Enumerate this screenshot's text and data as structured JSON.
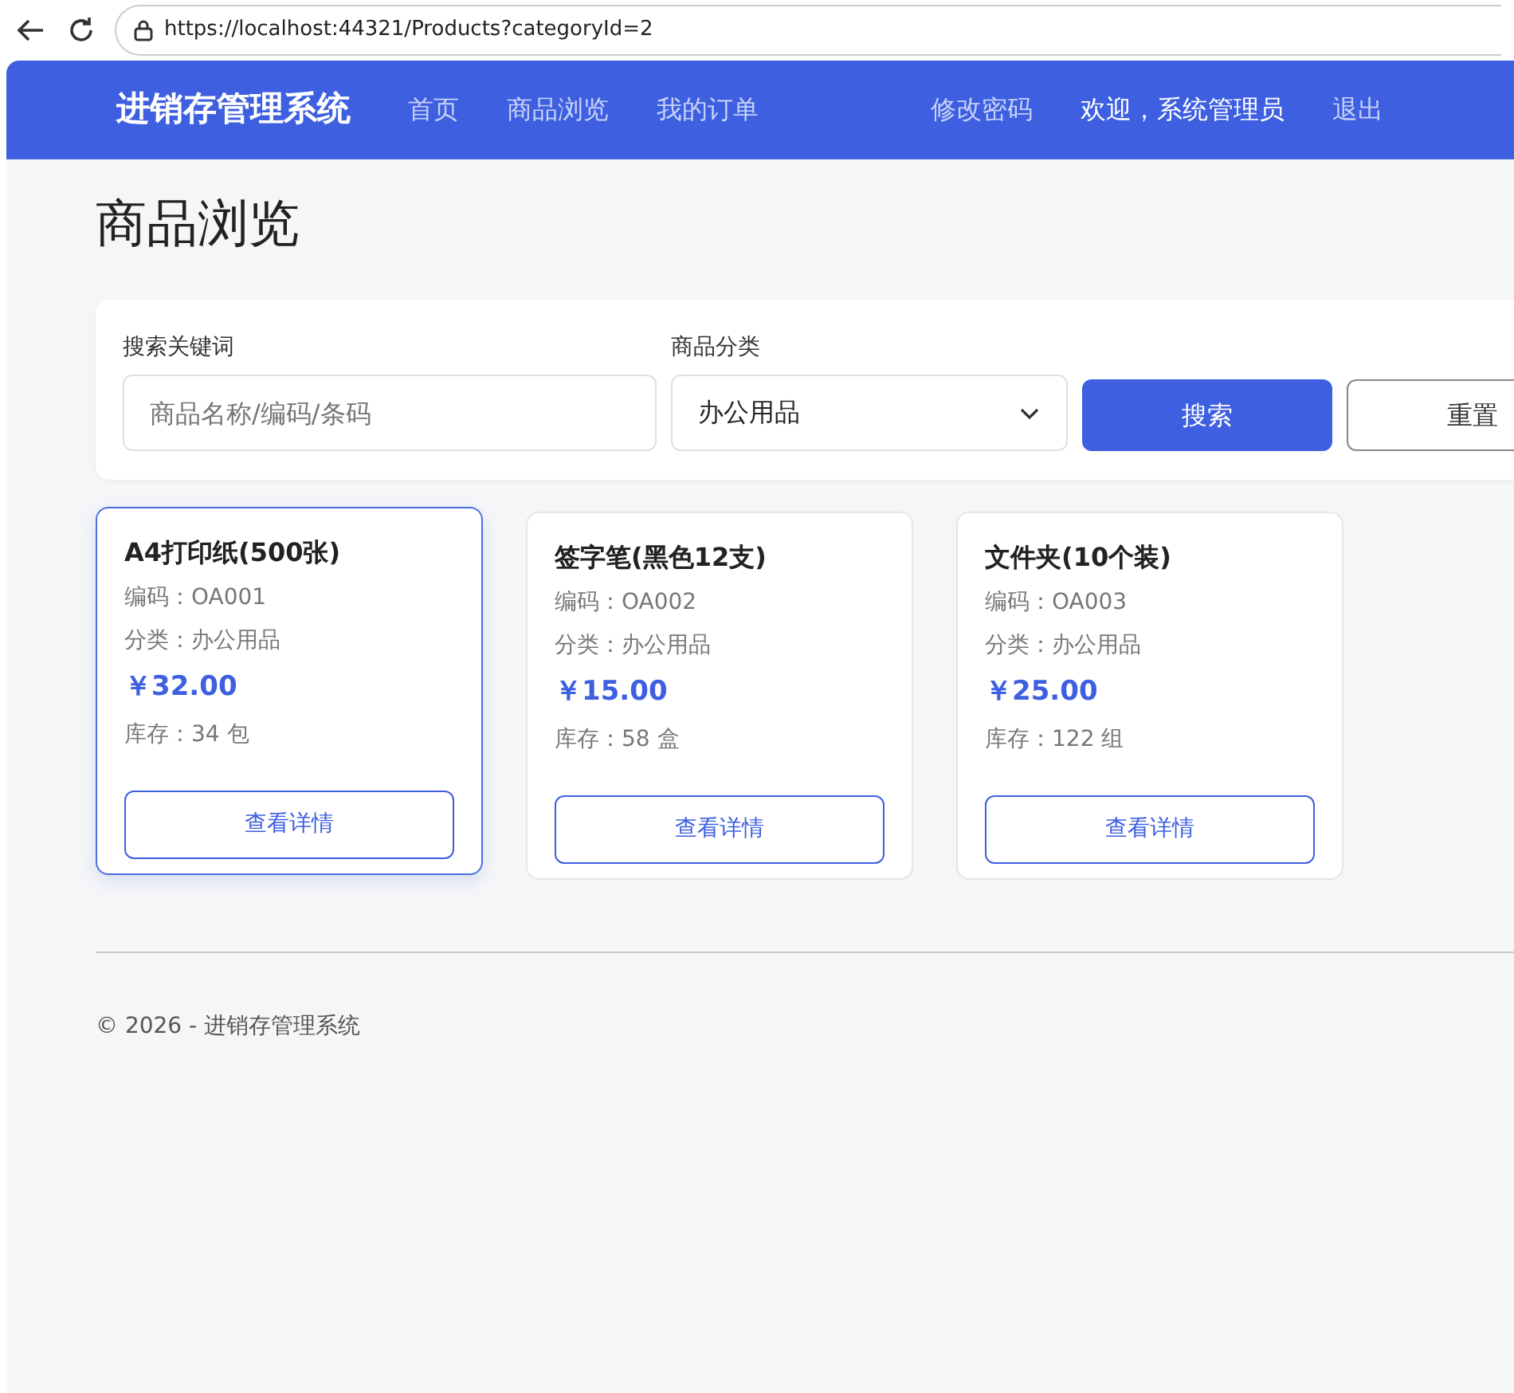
{
  "browser": {
    "url": "https://localhost:44321/Products?categoryId=2"
  },
  "navbar": {
    "brand": "进销存管理系统",
    "links": [
      "首页",
      "商品浏览",
      "我的订单"
    ],
    "right_links": [
      {
        "kind": "link",
        "label": "修改密码"
      },
      {
        "kind": "text",
        "label": "欢迎，系统管理员"
      },
      {
        "kind": "link",
        "label": "退出"
      }
    ]
  },
  "page_title": "商品浏览",
  "filter": {
    "keyword_label": "搜索关键词",
    "keyword_placeholder": "商品名称/编码/条码",
    "category_label": "商品分类",
    "category_value": "办公用品",
    "search_button": "搜索",
    "reset_button": "重置"
  },
  "products": [
    {
      "name": "A4打印纸(500张)",
      "code": "编码：OA001",
      "category": "分类：办公用品",
      "price": "￥32.00",
      "stock": "库存：34 包",
      "button": "查看详情",
      "selected": true
    },
    {
      "name": "签字笔(黑色12支)",
      "code": "编码：OA002",
      "category": "分类：办公用品",
      "price": "￥15.00",
      "stock": "库存：58 盒",
      "button": "查看详情",
      "selected": false
    },
    {
      "name": "文件夹(10个装)",
      "code": "编码：OA003",
      "category": "分类：办公用品",
      "price": "￥25.00",
      "stock": "库存：122 组",
      "button": "查看详情",
      "selected": false
    }
  ],
  "footer": "© 2026 - 进销存管理系统"
}
